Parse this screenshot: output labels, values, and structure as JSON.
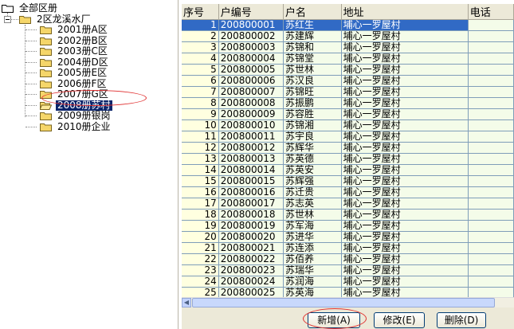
{
  "tree": {
    "root": "全部区册",
    "group": "2区龙溪水厂",
    "items": [
      "2001册A区",
      "2002册B区",
      "2003册C区",
      "2004册D区",
      "2005册E区",
      "2006册F区",
      "2007册G区",
      "2008册苏村",
      "2009册银岗",
      "2010册企业"
    ],
    "selected_index": 7
  },
  "grid": {
    "columns": [
      "序号",
      "户编号",
      "户名",
      "地址",
      "电话"
    ],
    "rows": [
      [
        "1",
        "200800001",
        "苏红生",
        "埔心一罗屋村",
        ""
      ],
      [
        "2",
        "200800002",
        "苏建辉",
        "埔心一罗屋村",
        ""
      ],
      [
        "3",
        "200800003",
        "苏锦和",
        "埔心一罗屋村",
        ""
      ],
      [
        "4",
        "200800004",
        "苏锦堂",
        "埔心一罗屋村",
        ""
      ],
      [
        "5",
        "200800005",
        "苏世林",
        "埔心一罗屋村",
        ""
      ],
      [
        "6",
        "200800006",
        "苏汉良",
        "埔心一罗屋村",
        ""
      ],
      [
        "7",
        "200800007",
        "苏锦旺",
        "埔心一罗屋村",
        ""
      ],
      [
        "8",
        "200800008",
        "苏振鹏",
        "埔心一罗屋村",
        ""
      ],
      [
        "9",
        "200800009",
        "苏容胜",
        "埔心一罗屋村",
        ""
      ],
      [
        "10",
        "200800010",
        "苏锦湘",
        "埔心一罗屋村",
        ""
      ],
      [
        "11",
        "200800011",
        "苏宇良",
        "埔心一罗屋村",
        ""
      ],
      [
        "12",
        "200800012",
        "苏辉华",
        "埔心一罗屋村",
        ""
      ],
      [
        "13",
        "200800013",
        "苏英德",
        "埔心一罗屋村",
        ""
      ],
      [
        "14",
        "200800014",
        "苏英安",
        "埔心一罗屋村",
        ""
      ],
      [
        "15",
        "200800015",
        "苏辉强",
        "埔心一罗屋村",
        ""
      ],
      [
        "16",
        "200800016",
        "苏迁贵",
        "埔心一罗屋村",
        ""
      ],
      [
        "17",
        "200800017",
        "苏志英",
        "埔心一罗屋村",
        ""
      ],
      [
        "18",
        "200800018",
        "苏世林",
        "埔心一罗屋村",
        ""
      ],
      [
        "19",
        "200800019",
        "苏军海",
        "埔心一罗屋村",
        ""
      ],
      [
        "20",
        "200800020",
        "苏进华",
        "埔心一罗屋村",
        ""
      ],
      [
        "21",
        "200800021",
        "苏连添",
        "埔心一罗屋村",
        ""
      ],
      [
        "22",
        "200800022",
        "苏佰养",
        "埔心一罗屋村",
        ""
      ],
      [
        "23",
        "200800023",
        "苏瑞华",
        "埔心一罗屋村",
        ""
      ],
      [
        "24",
        "200800024",
        "苏润海",
        "埔心一罗屋村",
        ""
      ],
      [
        "25",
        "200800025",
        "苏英海",
        "埔心一罗屋村",
        ""
      ]
    ],
    "selected_row": 0
  },
  "buttons": {
    "add": "新增(A)",
    "edit": "修改(E)",
    "delete": "删除(D)"
  },
  "colors": {
    "selection": "#0a246a",
    "row_highlight": "#316ac5",
    "annotation": "#e03030"
  }
}
